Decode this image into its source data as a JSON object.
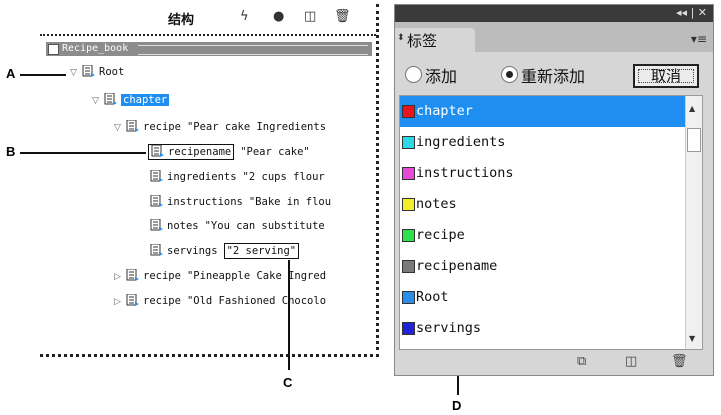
{
  "structure": {
    "title": "结构",
    "root_element": "Recipe_book",
    "nodes": [
      {
        "tag": "Root",
        "value": "",
        "twisty": "expanded"
      },
      {
        "tag": "chapter",
        "value": "",
        "twisty": "expanded"
      },
      {
        "tag": "recipe",
        "value": "\"Pear cake Ingredients",
        "twisty": "expanded"
      },
      {
        "tag": "recipename",
        "value": "\"Pear cake\"",
        "twisty": "none"
      },
      {
        "tag": "ingredients",
        "value": "\"2 cups flour",
        "twisty": "none"
      },
      {
        "tag": "instructions",
        "value": "\"Bake in flou",
        "twisty": "none"
      },
      {
        "tag": "notes",
        "value": "\"You can substitute",
        "twisty": "none"
      },
      {
        "tag": "servings",
        "value": "\"2 serving\"",
        "twisty": "none"
      },
      {
        "tag": "recipe",
        "value": "\"Pineapple Cake Ingred",
        "twisty": "collapsed"
      },
      {
        "tag": "recipe",
        "value": "\"Old Fashioned Chocolo",
        "twisty": "collapsed"
      }
    ]
  },
  "callouts": {
    "a": "A",
    "b": "B",
    "c": "C",
    "d": "D"
  },
  "tags_panel": {
    "tab_label": "标签",
    "options": {
      "add": "添加",
      "retag": "重新添加",
      "selected": "retag"
    },
    "cancel_label": "取消",
    "items": [
      {
        "name": "chapter",
        "color": "#e8141e",
        "active": true
      },
      {
        "name": "ingredients",
        "color": "#2ed8e6",
        "active": false
      },
      {
        "name": "instructions",
        "color": "#e84ad8",
        "active": false
      },
      {
        "name": "notes",
        "color": "#f2ee2a",
        "active": false
      },
      {
        "name": "recipe",
        "color": "#2ee04a",
        "active": false
      },
      {
        "name": "recipename",
        "color": "#7a7a7a",
        "active": false
      },
      {
        "name": "Root",
        "color": "#2a8ee6",
        "active": false
      },
      {
        "name": "servings",
        "color": "#2222d8",
        "active": false
      }
    ]
  }
}
